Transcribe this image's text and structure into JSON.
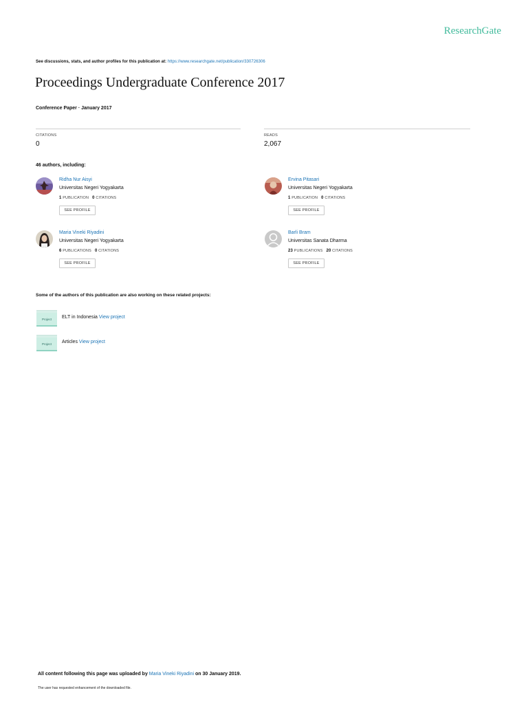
{
  "brand": {
    "logo": "ResearchGate",
    "accent": "#40ba9b",
    "link_color": "#1a73b5"
  },
  "header": {
    "discussion_text": "See discussions, stats, and author profiles for this publication at:",
    "publication_url": "https://www.researchgate.net/publication/330726306"
  },
  "publication": {
    "title": "Proceedings Undergraduate Conference 2017",
    "type_date": "Conference Paper · January 2017"
  },
  "stats": {
    "citations_label": "CITATIONS",
    "citations_value": "0",
    "reads_label": "READS",
    "reads_value": "2,067"
  },
  "authors_count": "46 authors, including:",
  "authors": [
    {
      "name": "Ridha Nur Aisyi",
      "institution": "Universitas Negeri Yogyakarta",
      "pubs": "1",
      "pubs_label": "PUBLICATION",
      "cits": "0",
      "cits_label": "CITATIONS",
      "button": "SEE PROFILE",
      "avatar": "photo"
    },
    {
      "name": "Ervina Pitasari",
      "institution": "Universitas Negeri Yogyakarta",
      "pubs": "1",
      "pubs_label": "PUBLICATION",
      "cits": "0",
      "cits_label": "CITATIONS",
      "button": "SEE PROFILE",
      "avatar": "photo"
    },
    {
      "name": "Maria Vineki Riyadini",
      "institution": "Universitas Negeri Yogyakarta",
      "pubs": "6",
      "pubs_label": "PUBLICATIONS",
      "cits": "0",
      "cits_label": "CITATIONS",
      "button": "SEE PROFILE",
      "avatar": "photo"
    },
    {
      "name": "Barli Bram",
      "institution": "Universitas Sanata Dharma",
      "pubs": "23",
      "pubs_label": "PUBLICATIONS",
      "cits": "20",
      "cits_label": "CITATIONS",
      "button": "SEE PROFILE",
      "avatar": "default-user-icon"
    }
  ],
  "related": {
    "heading": "Some of the authors of this publication are also working on these related projects:",
    "projects": [
      {
        "folder_label": "Project",
        "name": "ELT in Indonesia",
        "link": "View project"
      },
      {
        "folder_label": "Project",
        "name": "Articles",
        "link": "View project"
      }
    ]
  },
  "footer": {
    "upload_prefix": "All content following this page was uploaded by",
    "uploader": "Maria Vineki Riyadini",
    "upload_suffix": "on 30 January 2019.",
    "note": "The user has requested enhancement of the downloaded file."
  }
}
